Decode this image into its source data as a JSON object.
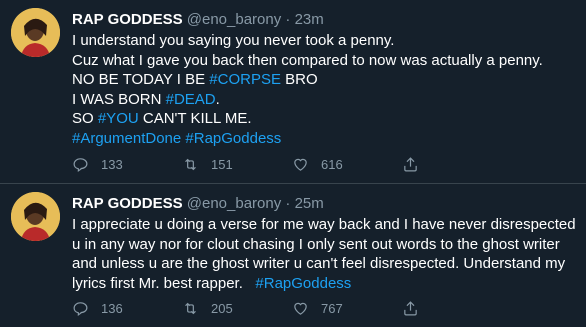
{
  "tweets": [
    {
      "name": "RAP GODDESS",
      "handle": "@eno_barony",
      "separator": "·",
      "time": "23m",
      "lines": [
        [
          {
            "t": "I understand you saying you never took a penny."
          }
        ],
        [
          {
            "t": "Cuz what I gave you back then compared to now was actually a penny."
          }
        ],
        [
          {
            "t": "NO BE TODAY I BE "
          },
          {
            "t": "#CORPSE",
            "tag": true
          },
          {
            "t": " BRO"
          }
        ],
        [
          {
            "t": "I WAS BORN "
          },
          {
            "t": "#DEAD",
            "tag": true
          },
          {
            "t": "."
          }
        ],
        [
          {
            "t": "SO "
          },
          {
            "t": "#YOU",
            "tag": true
          },
          {
            "t": " CAN'T KILL ME."
          }
        ],
        [
          {
            "t": "#ArgumentDone",
            "tag": true
          },
          {
            "t": " "
          },
          {
            "t": "#RapGoddess",
            "tag": true
          }
        ]
      ],
      "replies": "133",
      "retweets": "151",
      "likes": "616"
    },
    {
      "name": "RAP GODDESS",
      "handle": "@eno_barony",
      "separator": "·",
      "time": "25m",
      "lines": [
        [
          {
            "t": "I appreciate u doing a verse for me way back and I have never disrespected"
          }
        ],
        [
          {
            "t": "u in any way nor for clout chasing I only sent out words to the ghost writer"
          }
        ],
        [
          {
            "t": "and unless u are the ghost writer u can't feel disrespected. Understand my"
          }
        ],
        [
          {
            "t": "lyrics first Mr. best rapper.   "
          },
          {
            "t": "#RapGoddess",
            "tag": true
          }
        ]
      ],
      "replies": "136",
      "retweets": "205",
      "likes": "767"
    }
  ],
  "icons": {
    "reply": "reply-icon",
    "retweet": "retweet-icon",
    "like": "heart-icon",
    "share": "share-icon"
  },
  "colors": {
    "background": "#15202b",
    "hashtag": "#1da1f2",
    "secondary_text": "#8899a6",
    "divider": "#38444d"
  }
}
